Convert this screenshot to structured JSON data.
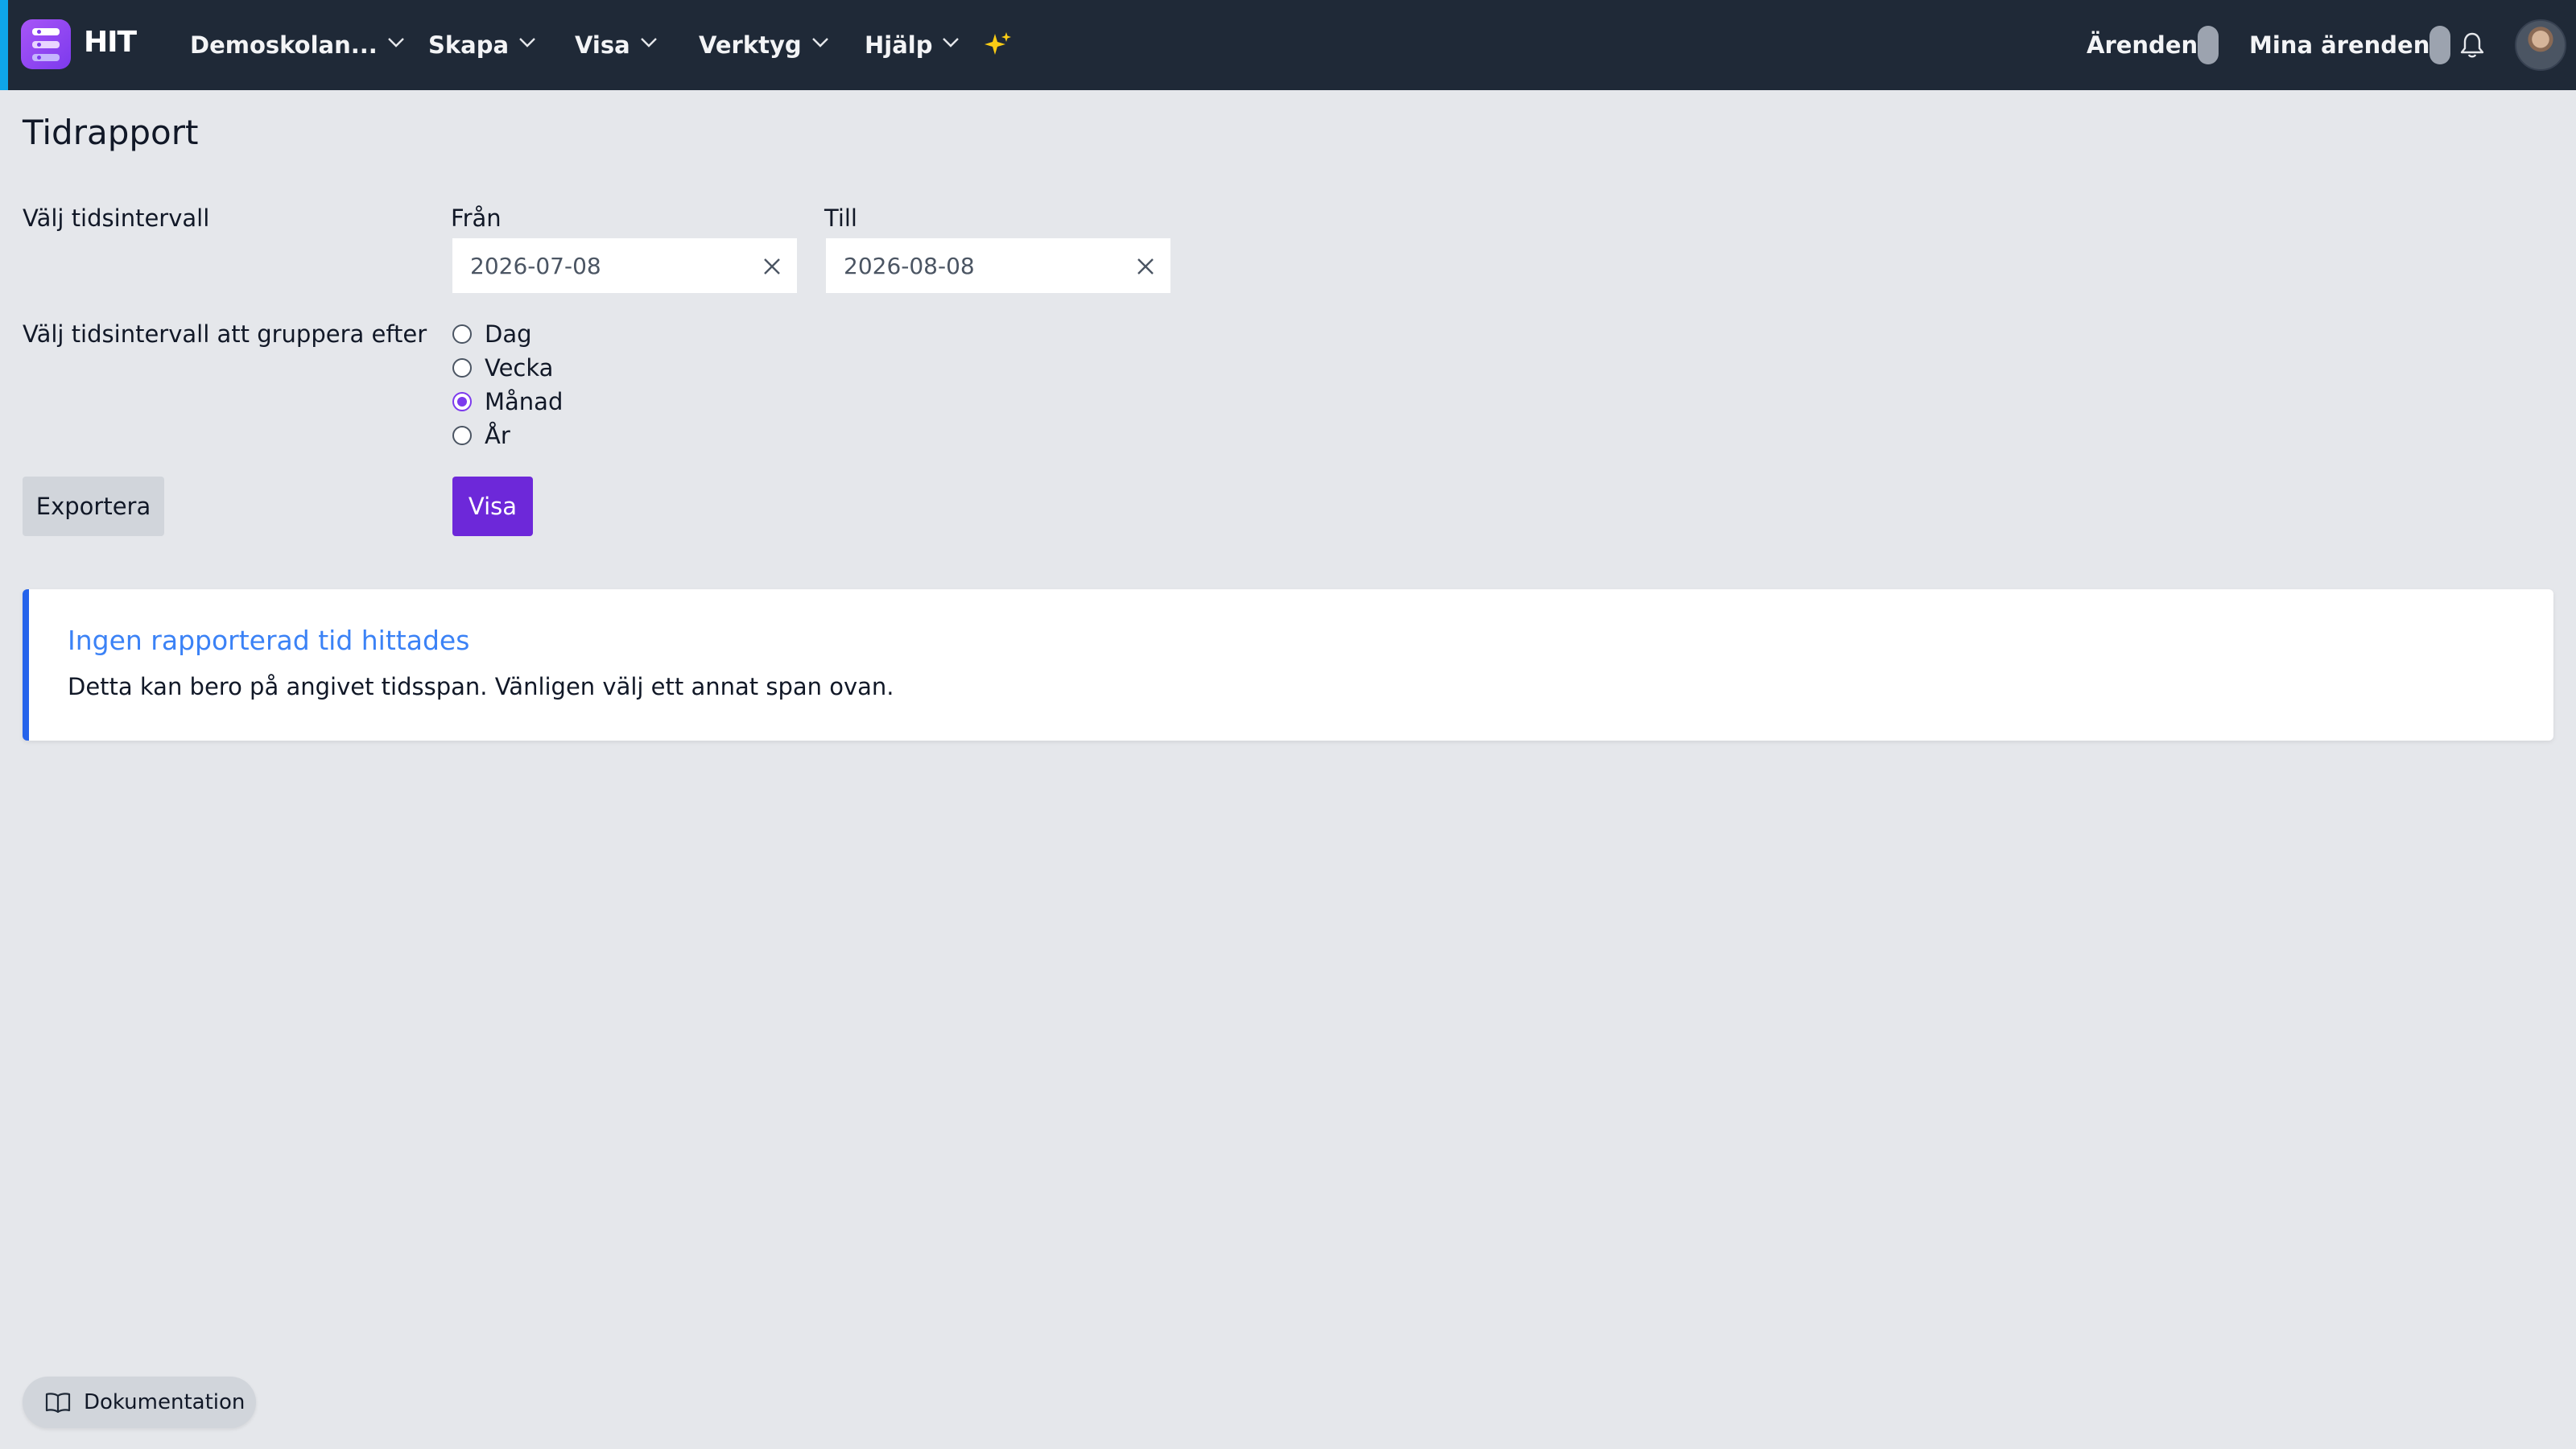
{
  "navbar": {
    "brand": "HIT",
    "menus": [
      {
        "label": "Demoskolan..."
      },
      {
        "label": "Skapa"
      },
      {
        "label": "Visa"
      },
      {
        "label": "Verktyg"
      },
      {
        "label": "Hjälp"
      }
    ],
    "arenden_label": "Ärenden",
    "mina_arenden_label": "Mina ärenden",
    "colors": {
      "bg": "#1f2937",
      "accent": "#0ea5e9",
      "sparkle": "#facc15"
    }
  },
  "page": {
    "title": "Tidrapport",
    "interval_label": "Välj tidsintervall",
    "from_label": "Från",
    "from_value": "2026-07-08",
    "to_label": "Till",
    "to_value": "2026-08-08",
    "group_label": "Välj tidsintervall att gruppera efter",
    "group_options": [
      {
        "label": "Dag",
        "checked": false
      },
      {
        "label": "Vecka",
        "checked": false
      },
      {
        "label": "Månad",
        "checked": true
      },
      {
        "label": "År",
        "checked": false
      }
    ],
    "export_button": "Exportera",
    "show_button": "Visa"
  },
  "alert": {
    "title": "Ingen rapporterad tid hittades",
    "text": "Detta kan bero på angivet tidsspan. Vänligen välj ett annat span ovan."
  },
  "footer": {
    "doc_button": "Dokumentation"
  }
}
